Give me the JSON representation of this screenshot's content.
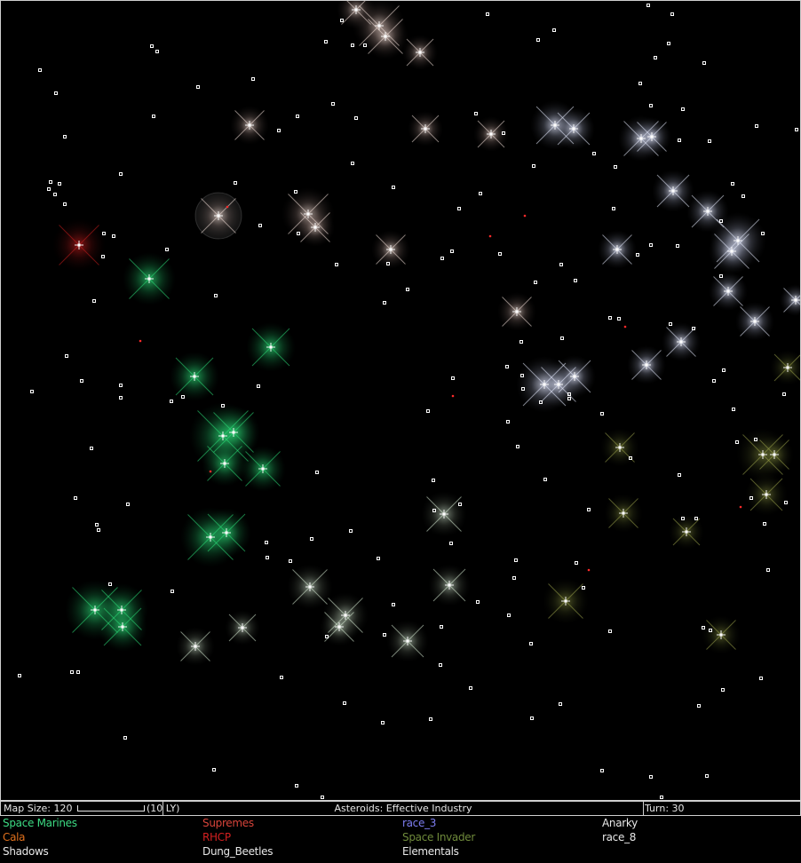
{
  "status": {
    "map_size_label": "Map Size: 120",
    "scale_label": "(10 LY)",
    "center_text": "Asteroids: Effective Industry",
    "turn_label": "Turn: 30"
  },
  "races": [
    {
      "name": "Space Marines",
      "color": "#3ddc84"
    },
    {
      "name": "Supremes",
      "color": "#d9443a"
    },
    {
      "name": "race_3",
      "color": "#7d7df0"
    },
    {
      "name": "Anarky",
      "color": "#e8e8e8"
    },
    {
      "name": "Cala",
      "color": "#e0701c"
    },
    {
      "name": "RHCP",
      "color": "#d42020"
    },
    {
      "name": "Space Invader",
      "color": "#6f8a3b"
    },
    {
      "name": "race_8",
      "color": "#e8e8e8"
    },
    {
      "name": "Shadows",
      "color": "#e8e8e8"
    },
    {
      "name": "Dung_Beetles",
      "color": "#e8e8e8"
    },
    {
      "name": "Elementals",
      "color": "#e8e8e8"
    }
  ],
  "colors": {
    "green_owner": "#2ee07a",
    "white_owner": "#e8ecff",
    "warm_owner": "#f2e0d8",
    "olive_owner": "#9aa34a",
    "red_owner": "#c81e1e",
    "neutral_planet": "#ffffff",
    "hostile_dot": "#ff2a2a"
  }
}
